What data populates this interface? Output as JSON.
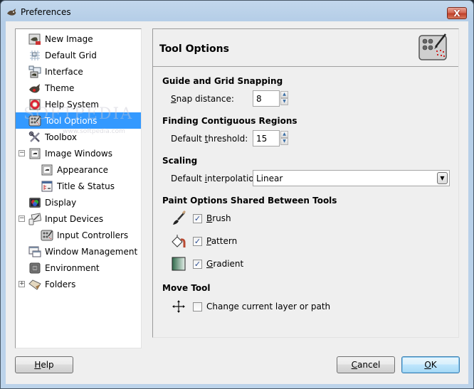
{
  "window": {
    "title": "Preferences",
    "close_label": "X"
  },
  "sidebar": {
    "items": [
      {
        "label": "New Image",
        "icon": "new-image-icon"
      },
      {
        "label": "Default Grid",
        "icon": "grid-icon"
      },
      {
        "label": "Interface",
        "icon": "interface-icon"
      },
      {
        "label": "Theme",
        "icon": "theme-icon"
      },
      {
        "label": "Help System",
        "icon": "help-system-icon"
      },
      {
        "label": "Tool Options",
        "icon": "tool-options-icon",
        "selected": true
      },
      {
        "label": "Toolbox",
        "icon": "toolbox-icon"
      },
      {
        "label": "Image Windows",
        "icon": "image-windows-icon",
        "expander": "minus"
      },
      {
        "label": "Appearance",
        "icon": "appearance-icon"
      },
      {
        "label": "Title & Status",
        "icon": "title-status-icon"
      },
      {
        "label": "Display",
        "icon": "display-icon"
      },
      {
        "label": "Input Devices",
        "icon": "input-devices-icon",
        "expander": "minus"
      },
      {
        "label": "Input Controllers",
        "icon": "input-controllers-icon"
      },
      {
        "label": "Window Management",
        "icon": "window-management-icon"
      },
      {
        "label": "Environment",
        "icon": "environment-icon"
      },
      {
        "label": "Folders",
        "icon": "folders-icon",
        "expander": "plus"
      }
    ],
    "expander_minus": "−",
    "expander_plus": "+"
  },
  "watermark": {
    "text": "SOFTPEDIA",
    "url_text": "www.softpedia.com"
  },
  "panel": {
    "title": "Tool Options",
    "sections": {
      "snapping": {
        "title": "Guide and Grid Snapping",
        "snap_label_mnemonic": "S",
        "snap_label_rest": "nap distance:",
        "snap_value": "8"
      },
      "contiguous": {
        "title": "Finding Contiguous Regions",
        "threshold_label_pre": "Default ",
        "threshold_label_mnemonic": "t",
        "threshold_label_rest": "hreshold:",
        "threshold_value": "15"
      },
      "scaling": {
        "title": "Scaling",
        "interp_label_pre": "Default ",
        "interp_label_mnemonic": "i",
        "interp_label_rest": "nterpolation:",
        "interp_value": "Linear"
      },
      "paint": {
        "title": "Paint Options Shared Between Tools",
        "options": [
          {
            "mnemonic": "B",
            "rest": "rush",
            "checked": true
          },
          {
            "mnemonic": "P",
            "rest": "attern",
            "checked": true
          },
          {
            "mnemonic": "G",
            "rest": "radient",
            "checked": true
          }
        ]
      },
      "move": {
        "title": "Move Tool",
        "option_label": "Change current layer or path",
        "checked": false
      }
    },
    "check_mark": "✓"
  },
  "buttons": {
    "help_mnemonic": "H",
    "help_rest": "elp",
    "cancel_mnemonic": "C",
    "cancel_rest": "ancel",
    "ok_mnemonic": "O",
    "ok_rest": "K"
  },
  "colors": {
    "selection": "#3399ff",
    "window_frame": "#b4cde7"
  }
}
